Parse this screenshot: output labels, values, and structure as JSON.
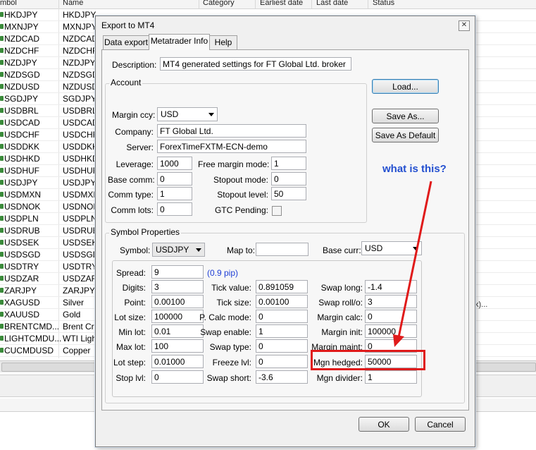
{
  "background_table": {
    "headers": [
      "mbol",
      "Name",
      "Category",
      "Earliest date",
      "Last date",
      "Status"
    ],
    "rows": [
      {
        "symbol": "HKDJPY",
        "name": "HKDJPY"
      },
      {
        "symbol": "MXNJPY",
        "name": "MXNJPY"
      },
      {
        "symbol": "NZDCAD",
        "name": "NZDCAD"
      },
      {
        "symbol": "NZDCHF",
        "name": "NZDCHF"
      },
      {
        "symbol": "NZDJPY",
        "name": "NZDJPY"
      },
      {
        "symbol": "NZDSGD",
        "name": "NZDSGD"
      },
      {
        "symbol": "NZDUSD",
        "name": "NZDUSD"
      },
      {
        "symbol": "SGDJPY",
        "name": "SGDJPY"
      },
      {
        "symbol": "USDBRL",
        "name": "USDBRL"
      },
      {
        "symbol": "USDCAD",
        "name": "USDCAD"
      },
      {
        "symbol": "USDCHF",
        "name": "USDCHF"
      },
      {
        "symbol": "USDDKK",
        "name": "USDDKK"
      },
      {
        "symbol": "USDHKD",
        "name": "USDHKD"
      },
      {
        "symbol": "USDHUF",
        "name": "USDHUF"
      },
      {
        "symbol": "USDJPY",
        "name": "USDJPY"
      },
      {
        "symbol": "USDMXN",
        "name": "USDMXN"
      },
      {
        "symbol": "USDNOK",
        "name": "USDNOK"
      },
      {
        "symbol": "USDPLN",
        "name": "USDPLN"
      },
      {
        "symbol": "USDRUB",
        "name": "USDRUB"
      },
      {
        "symbol": "USDSEK",
        "name": "USDSEK"
      },
      {
        "symbol": "USDSGD",
        "name": "USDSGD"
      },
      {
        "symbol": "USDTRY",
        "name": "USDTRY"
      },
      {
        "symbol": "USDZAR",
        "name": "USDZAR"
      },
      {
        "symbol": "ZARJPY",
        "name": "ZARJPY"
      },
      {
        "symbol": "XAGUSD",
        "name": "Silver"
      },
      {
        "symbol": "XAUUSD",
        "name": "Gold"
      },
      {
        "symbol": "BRENTCMD...",
        "name": "Brent Cruc"
      },
      {
        "symbol": "LIGHTCMDU...",
        "name": "WTI Light"
      },
      {
        "symbol": "CUCMDUSD",
        "name": "Copper"
      }
    ],
    "right_fragment": "k)..."
  },
  "dialog": {
    "title": "Export to MT4",
    "close_glyph": "✕",
    "tabs": [
      "Data export",
      "Metatrader Info",
      "Help"
    ],
    "active_tab": "Metatrader Info",
    "description_label": "Description:",
    "description_value": "MT4 generated settings for FT Global Ltd. broker",
    "buttons": {
      "load": "Load...",
      "save_as": "Save As...",
      "save_as_default": "Save As Default",
      "ok": "OK",
      "cancel": "Cancel"
    },
    "account": {
      "title": "Account",
      "margin_ccy_label": "Margin ccy:",
      "margin_ccy_value": "USD",
      "company_label": "Company:",
      "company_value": "FT Global Ltd.",
      "server_label": "Server:",
      "server_value": "ForexTimeFXTM-ECN-demo",
      "leverage_label": "Leverage:",
      "leverage_value": "1000",
      "base_comm_label": "Base comm:",
      "base_comm_value": "0",
      "comm_type_label": "Comm type:",
      "comm_type_value": "1",
      "comm_lots_label": "Comm lots:",
      "comm_lots_value": "0",
      "free_margin_mode_label": "Free margin mode:",
      "free_margin_mode_value": "1",
      "stopout_mode_label": "Stopout mode:",
      "stopout_mode_value": "0",
      "stopout_level_label": "Stopout level:",
      "stopout_level_value": "50",
      "gtc_pending_label": "GTC Pending:"
    },
    "symbol_properties": {
      "title": "Symbol Properties",
      "symbol_label": "Symbol:",
      "symbol_value": "USDJPY",
      "map_to_label": "Map to:",
      "map_to_value": "",
      "base_curr_label": "Base curr:",
      "base_curr_value": "USD",
      "spread_label": "Spread:",
      "spread_value": "9",
      "spread_pip": "(0.9 pip)",
      "digits_label": "Digits:",
      "digits_value": "3",
      "point_label": "Point:",
      "point_value": "0.00100",
      "lot_size_label": "Lot size:",
      "lot_size_value": "100000",
      "min_lot_label": "Min lot:",
      "min_lot_value": "0.01",
      "max_lot_label": "Max lot:",
      "max_lot_value": "100",
      "lot_step_label": "Lot step:",
      "lot_step_value": "0.01000",
      "stop_lvl_label": "Stop lvl:",
      "stop_lvl_value": "0",
      "tick_value_label": "Tick value:",
      "tick_value_value": "0.891059",
      "tick_size_label": "Tick size:",
      "tick_size_value": "0.00100",
      "p_calc_mode_label": "P. Calc mode:",
      "p_calc_mode_value": "0",
      "swap_enable_label": "Swap enable:",
      "swap_enable_value": "1",
      "swap_type_label": "Swap type:",
      "swap_type_value": "0",
      "freeze_lvl_label": "Freeze lvl:",
      "freeze_lvl_value": "0",
      "swap_short_label": "Swap short:",
      "swap_short_value": "-3.6",
      "swap_long_label": "Swap long:",
      "swap_long_value": "-1.4",
      "swap_roll_label": "Swap roll/o:",
      "swap_roll_value": "3",
      "margin_calc_label": "Margin calc:",
      "margin_calc_value": "0",
      "margin_init_label": "Margin init:",
      "margin_init_value": "100000",
      "margin_maint_label": "Margin maint:",
      "margin_maint_value": "0",
      "mgn_hedged_label": "Mgn hedged:",
      "mgn_hedged_value": "50000",
      "mgn_divider_label": "Mgn divider:",
      "mgn_divider_value": "1"
    }
  },
  "annotation": {
    "text": "what is this?",
    "color": "#2450d0",
    "arrow_color": "#e01a1a"
  }
}
